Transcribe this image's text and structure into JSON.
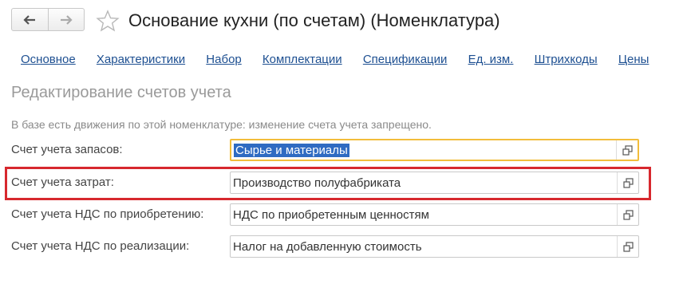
{
  "header": {
    "back_icon": "arrow-left-icon",
    "forward_icon": "arrow-right-icon",
    "favorite_icon": "star-icon",
    "title": "Основание кухни (по счетам) (Номенклатура)"
  },
  "tabs": [
    {
      "label": "Основное"
    },
    {
      "label": "Характеристики"
    },
    {
      "label": "Набор"
    },
    {
      "label": "Комплектации"
    },
    {
      "label": "Спецификации"
    },
    {
      "label": "Ед. изм."
    },
    {
      "label": "Штрихкоды"
    },
    {
      "label": "Цены"
    }
  ],
  "section": {
    "title": "Редактирование счетов учета",
    "notice": "В базе есть движения по этой номенклатуре: изменение счета учета запрещено."
  },
  "fields": [
    {
      "label": "Счет учета запасов:",
      "value": "Сырье и материалы"
    },
    {
      "label": "Счет учета затрат:",
      "value": "Производство полуфабриката"
    },
    {
      "label": "Счет учета НДС по приобретению:",
      "value": "НДС по приобретенным ценностям"
    },
    {
      "label": "Счет учета НДС по реализации:",
      "value": "Налог на добавленную стоимость"
    }
  ],
  "colors": {
    "link": "#1d4f91",
    "focus_border": "#f2bd3b",
    "selection": "#2f6bc2",
    "highlight": "#d7282e"
  }
}
